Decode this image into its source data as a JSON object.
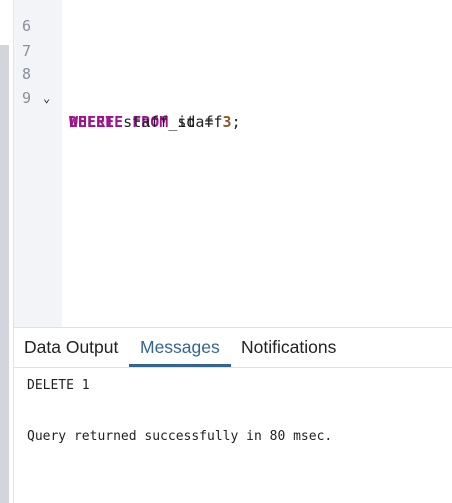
{
  "editor": {
    "lines": [
      {
        "number": "6",
        "text": ""
      },
      {
        "number": "7",
        "text": ""
      },
      {
        "number": "8",
        "kw1": "DELETE",
        "kw2": "FROM",
        "rest": " staff",
        "foldable": true
      },
      {
        "number": "9",
        "kw1": "WHERE",
        "rest": " staff_id = ",
        "num": "3",
        "end": ";"
      }
    ]
  },
  "tabs": [
    {
      "label": "Data Output",
      "active": false
    },
    {
      "label": "Messages",
      "active": true
    },
    {
      "label": "Notifications",
      "active": false
    }
  ],
  "messages": [
    "DELETE 1",
    "Query returned successfully in 80 msec."
  ],
  "colors": {
    "keyword": "#a0138e",
    "number": "#8a5a2b",
    "active_tab": "#326690"
  }
}
